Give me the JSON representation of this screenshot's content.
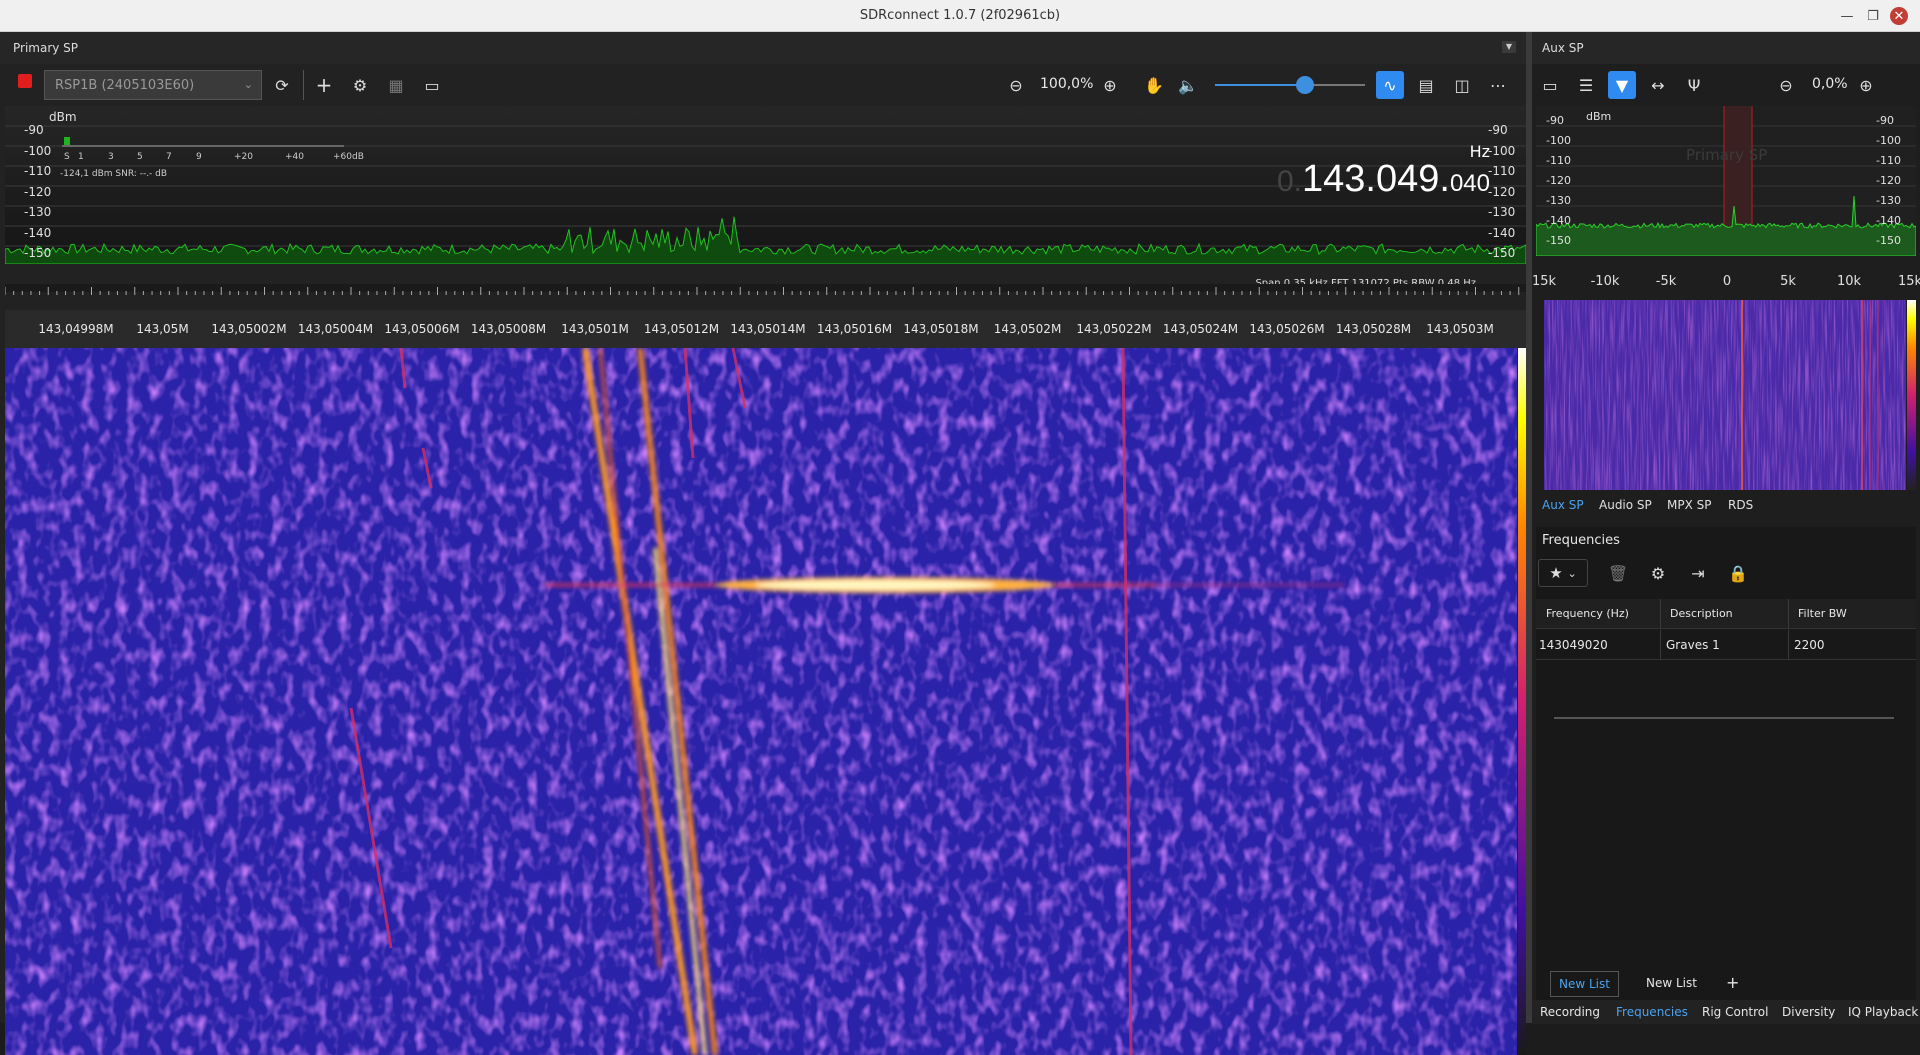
{
  "window": {
    "title": "SDRconnect 1.0.7 (2f02961cb)"
  },
  "primary": {
    "header_label": "Primary SP",
    "device": "RSP1B (2405103E60)",
    "zoom": "100,0%",
    "volume_level": 0.6,
    "y_unit": "dBm",
    "y_ticks_left": [
      "-90",
      "-100",
      "-110",
      "-120",
      "-130",
      "-140",
      "-150"
    ],
    "y_ticks_right": [
      "-90",
      "-100",
      "-110",
      "-120",
      "-130",
      "-140",
      "-150"
    ],
    "smeter_scale": [
      "S",
      "1",
      "3",
      "5",
      "7",
      "9",
      "+20",
      "+40",
      "+60dB"
    ],
    "smeter_reading": "-124,1 dBm  SNR:  --.- dB",
    "freq_hz_label": "Hz",
    "freq_dim": "0.",
    "freq_main": "143.049.",
    "freq_small": "040",
    "span_info": "Span 0,35 kHz  FFT 131072 Pts  RBW 0,48 Hz",
    "freq_axis": [
      "143,04998M",
      "143,05M",
      "143,05002M",
      "143,05004M",
      "143,05006M",
      "143,05008M",
      "143,0501M",
      "143,05012M",
      "143,05014M",
      "143,05016M",
      "143,05018M",
      "143,0502M",
      "143,05022M",
      "143,05024M",
      "143,05026M",
      "143,05028M",
      "143,0503M"
    ]
  },
  "aux": {
    "header_label": "Aux SP",
    "zoom": "0,0%",
    "y_unit": "dBm",
    "y_ticks_left": [
      "-90",
      "-100",
      "-110",
      "-120",
      "-130",
      "-140",
      "-150"
    ],
    "y_ticks_right": [
      "-90",
      "-100",
      "-110",
      "-120",
      "-130",
      "-140",
      "-150"
    ],
    "watermark": "Primary SP",
    "freq_axis": [
      "15k",
      "-10k",
      "-5k",
      "0",
      "5k",
      "10k",
      "15k"
    ],
    "tabs": [
      "Aux SP",
      "Audio SP",
      "MPX SP",
      "RDS"
    ],
    "active_tab": "Aux SP"
  },
  "frequencies": {
    "title": "Frequencies",
    "columns": [
      "Frequency (Hz)",
      "Description",
      "Filter BW"
    ],
    "rows": [
      {
        "frequency": "143049020",
        "description": "Graves 1",
        "filter_bw": "2200"
      }
    ],
    "list_tabs": [
      "New List",
      "New List"
    ],
    "add_label": "+"
  },
  "bottom_tabs": [
    "Recording",
    "Frequencies",
    "Rig Control",
    "Diversity",
    "IQ Playback"
  ],
  "active_bottom_tab": "Frequencies",
  "colors": {
    "accent": "#2f8bef",
    "record": "#e21d1d",
    "spectrum_green": "#1db51d",
    "waterfall_bg": "#2520a0"
  }
}
